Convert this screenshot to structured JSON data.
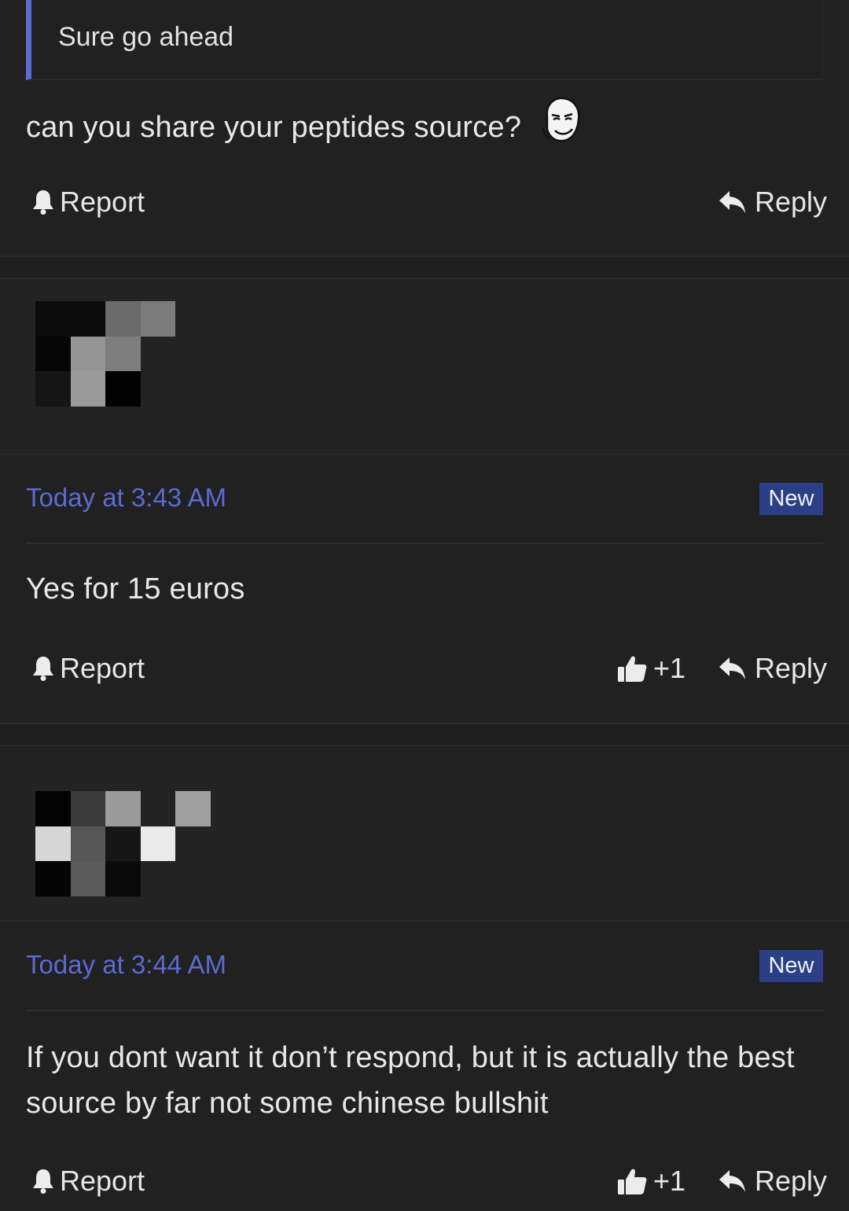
{
  "quote": {
    "text": "Sure go ahead"
  },
  "first_post": {
    "message": "can you share your peptides source?",
    "report_label": "Report",
    "reply_label": "Reply"
  },
  "posts": [
    {
      "timestamp": "Today at 3:43 AM",
      "badge": "New",
      "message": "Yes for 15 euros",
      "report_label": "Report",
      "like_count": "+1",
      "reply_label": "Reply",
      "avatar_colors": [
        "#0b0b0b",
        "#0b0b0b",
        "#6b6b6b",
        "#7b7b7b",
        "#232324",
        "#060606",
        "#959595",
        "#7e7e7e",
        "#232324",
        "#232324",
        "#151515",
        "#9a9a9a",
        "#020202",
        "#232324",
        "#232324"
      ]
    },
    {
      "timestamp": "Today at 3:44 AM",
      "badge": "New",
      "message": "If you dont want it don’t respond, but it is actually the best source by far not some chinese bullshit",
      "report_label": "Report",
      "like_count": "+1",
      "reply_label": "Reply",
      "avatar_colors": [
        "#030303",
        "#3a3a3a",
        "#9b9b9b",
        "#232324",
        "#a0a0a0",
        "#d7d7d7",
        "#565656",
        "#161616",
        "#eaeaea",
        "#232324",
        "#040404",
        "#5a5a5a",
        "#0a0a0a",
        "#232324",
        "#232324"
      ]
    }
  ]
}
